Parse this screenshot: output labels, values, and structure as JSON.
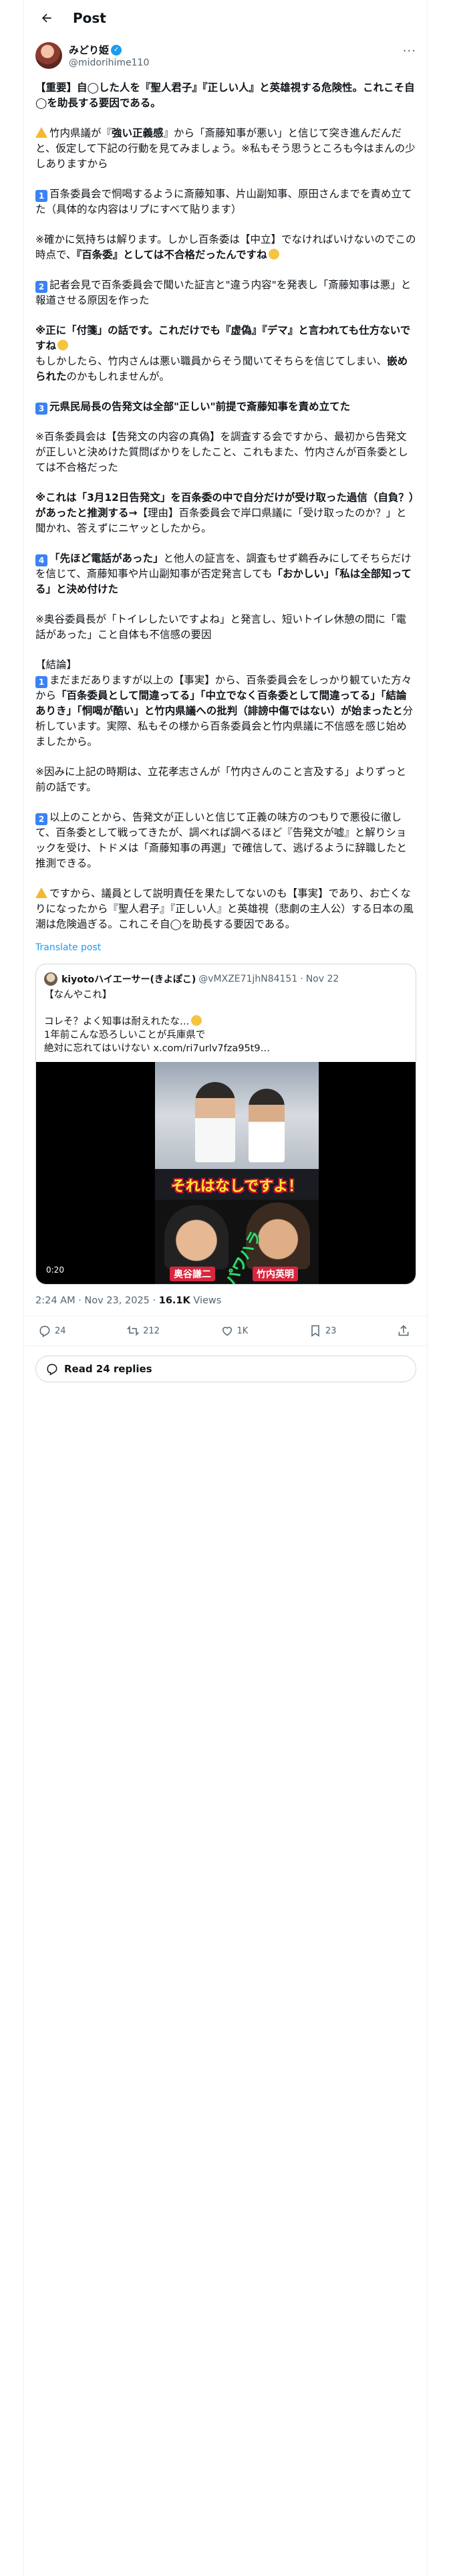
{
  "header": {
    "title": "Post"
  },
  "author": {
    "name": "みどり姫",
    "handle": "@midorihime110"
  },
  "tweet": {
    "p1": "【重要】自◯した人を『聖人君子』『正しい人』と英雄視する危険性。これこそ自◯を助長する要因である。",
    "p2a": "竹内県議が『",
    "p2b": "強い正義感",
    "p2c": "』から「斎藤知事が悪い」と信じて突き進んだんだと、仮定して下記の行動を見てみましょう。※私もそう思うところも今はまんの少しありますから",
    "p3_num": "1",
    "p3": "百条委員会で恫喝するように斎藤知事、片山副知事、原田さんまでを責め立てた（具体的な内容はリプにすべて貼ります）",
    "p4a": "※確かに気持ちは解ります。しかし百条委は【中立】でなければいけないのでこの時点で、",
    "p4b": "『百条委』としては不合格だったんですね",
    "p5_num": "2",
    "p5": "記者会見で百条委員会で聞いた証言と\"違う内容\"を発表し「斎藤知事は悪」と報道させる原因を作った",
    "p6a": "※正に「付箋」の話です。これだけでも『虚偽』『デマ』と言われても仕方ないですね",
    "p6b": "もしかしたら、竹内さんは悪い職員からそう聞いてそちらを信じてしまい、",
    "p6c": "嵌められた",
    "p6d": "のかもしれませんが。",
    "p7_num": "3",
    "p7": "元県民局長の告発文は全部\"正しい\"前提で斎藤知事を責め立てた",
    "p8": "※百条委員会は【告発文の内容の真偽】を調査する会ですから、最初から告発文が正しいと決めけた質問ばかりをしたこと、これもまた、竹内さんが百条委としては不合格だった",
    "p9a": "※これは「3月12日告発文」を百条委の中で自分だけが受け取った過信（自負？）があったと推測する→",
    "p9b": "【理由】百条委員会で岸口県議に「受け取ったのか？」と聞かれ、答えずにニヤッとしたから。",
    "p10_num": "4",
    "p10a": "「先ほど電話があった」",
    "p10b": "と他人の証言を、調査もせず鵜呑みにしてそちらだけを信じて、斎藤知事や片山副知事が否定発言しても",
    "p10c": "「おかしい」「私は全部知ってる」と決め付けた",
    "p11": "※奥谷委員長が「トイレしたいですよね」と発言し、短いトイレ休憩の間に「電話があった」こと自体も不信感の要因",
    "p12a": "【結論】",
    "p12_num": "1",
    "p12b": "まだまだありますが以上の【事実】から、百条委員会をしっかり観ていた方々から",
    "p12c": "「百条委員として間違ってる」「中立でなく百条委として間違ってる」「結論ありき」「恫喝が酷い」と竹内県議への批判（誹謗中傷ではない）が始まったと",
    "p12d": "分析しています。実際、私もその様から百条委員会と竹内県議に不信感を感じ始めましたから。",
    "p13": "※因みに上記の時期は、立花孝志さんが「竹内さんのこと言及する」よりずっと前の話です。",
    "p14_num": "2",
    "p14": "以上のことから、告発文が正しいと信じて正義の味方のつもりで悪役に徹して、百条委として戦ってきたが、調べれば調べるほど『告発文が嘘』と解りショックを受け、トドメは「斎藤知事の再選」で確信して、逃げるように辞職したと推測できる。",
    "p15a": "ですから、議員として説明責任を果たしてないのも【事実】であり、お亡くなりになったから『聖人君子』『正しい人』と英雄視（悲劇の主人公）する日本の風潮は危険過ぎる。これこそ自◯を助長する要因である。",
    "translate": "Translate post"
  },
  "quote": {
    "name": "kiyotoハイエーサー(きよぽこ)",
    "handle": "@vMXZE71jhN84151",
    "date": "Nov 22",
    "line1": "【なんやこれ】",
    "line2": "コレそ？よく知事は耐えれたな…",
    "line3": "1年前こんな恐ろしいことが兵庫県で",
    "line4": "絶対に忘れてはいけない x.com/ri7urlv7fza95t9…",
    "caption": "それはなしですよ！",
    "diag_text": "パワハラ",
    "tag1": "奥谷謙二",
    "tag2": "竹内英明",
    "duration": "0:20"
  },
  "meta": {
    "time": "2:24 AM · Nov 23, 2025",
    "sep": " · ",
    "views_num": "16.1K",
    "views_label": " Views"
  },
  "actions": {
    "replies": "24",
    "reposts": "212",
    "likes": "1K",
    "bookmarks": "23"
  },
  "replies_button": "Read 24 replies"
}
